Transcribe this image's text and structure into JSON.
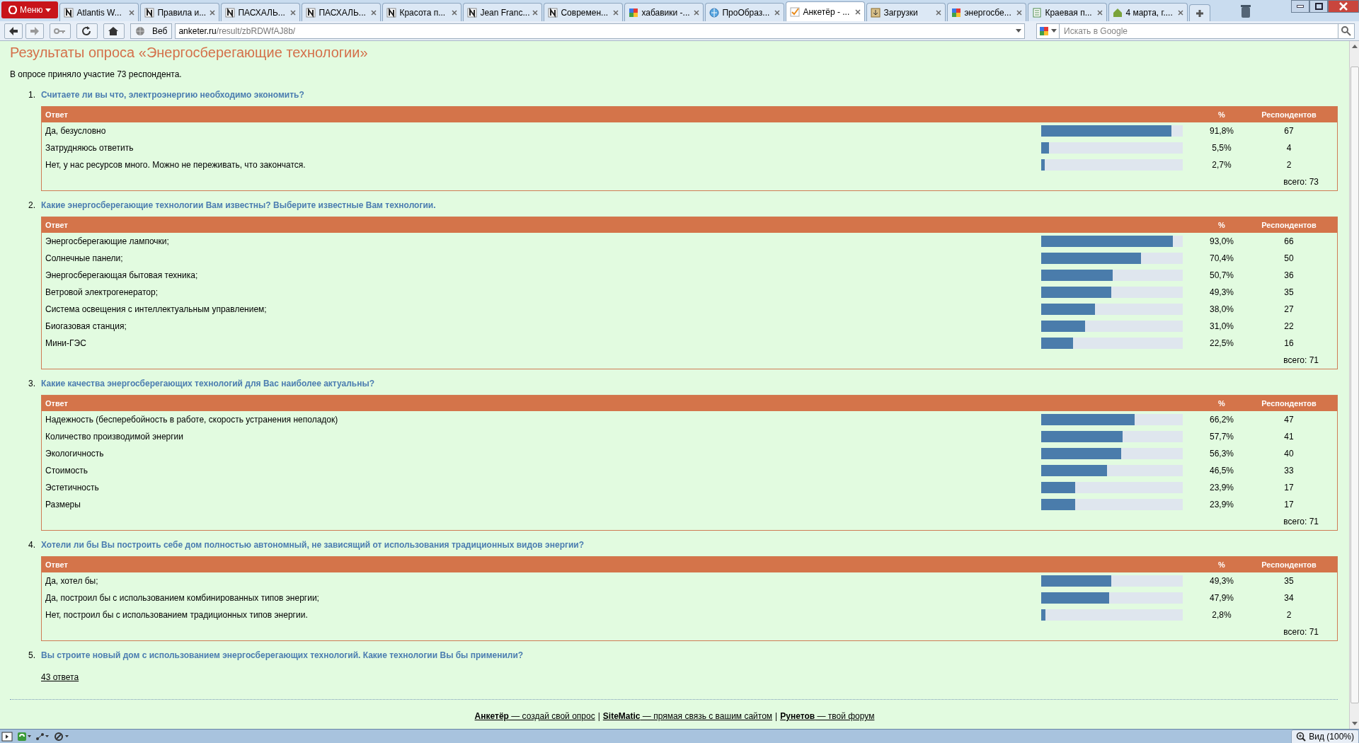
{
  "browser": {
    "menu_label": "Меню",
    "tabs": [
      {
        "title": "Atlantis W...",
        "kind": "n",
        "selected": false
      },
      {
        "title": "Правила и...",
        "kind": "n",
        "selected": false
      },
      {
        "title": "ПАСХАЛЬ...",
        "kind": "n",
        "selected": false
      },
      {
        "title": "ПАСХАЛЬ...",
        "kind": "n",
        "selected": false
      },
      {
        "title": "Красота п...",
        "kind": "n",
        "selected": false
      },
      {
        "title": "Jean Franc...",
        "kind": "n",
        "selected": false
      },
      {
        "title": "Современ...",
        "kind": "n",
        "selected": false
      },
      {
        "title": "хабавики -...",
        "kind": "google",
        "selected": false
      },
      {
        "title": "ПроОбраз...",
        "kind": "globe",
        "selected": false
      },
      {
        "title": "Анкетёр - ...",
        "kind": "check",
        "selected": true
      },
      {
        "title": "Загрузки",
        "kind": "download",
        "selected": false
      },
      {
        "title": "энергосбе...",
        "kind": "google",
        "selected": false
      },
      {
        "title": "Краевая п...",
        "kind": "doc",
        "selected": false
      },
      {
        "title": "4 марта, г....",
        "kind": "house",
        "selected": false
      }
    ],
    "site_label": "Веб",
    "url_host": "anketer.ru",
    "url_path": "/result/zbRDWfAJ8b/",
    "search_placeholder": "Искать в Google",
    "zoom_label": "Вид (100%)"
  },
  "page": {
    "title": "Результаты опроса «Энергосберегающие технологии»",
    "intro": "В опросе приняло участие 73 респондента.",
    "questions": [
      {
        "number": "1.",
        "text": "Считаете ли вы что, электроэнергию необходимо экономить?",
        "columns": [
          "Ответ",
          "%",
          "Респондентов"
        ],
        "total": "всего: 73",
        "rows": [
          {
            "answer": "Да, безусловно",
            "level": 0.918,
            "percent": "91,8%",
            "count": "67"
          },
          {
            "answer": "Затрудняюсь ответить",
            "level": 0.055,
            "percent": "5,5%",
            "count": "4"
          },
          {
            "answer": "Нет, у нас ресурсов много. Можно не переживать, что закончатся.",
            "level": 0.027,
            "percent": "2,7%",
            "count": "2"
          }
        ]
      },
      {
        "number": "2.",
        "text": "Какие энергосберегающие технологии Вам известны? Выберите известные Вам технологии.",
        "columns": [
          "Ответ",
          "%",
          "Респондентов"
        ],
        "total": "всего: 71",
        "rows": [
          {
            "answer": "Энергосберегающие лампочки;",
            "level": 0.93,
            "percent": "93,0%",
            "count": "66"
          },
          {
            "answer": "Солнечные панели;",
            "level": 0.704,
            "percent": "70,4%",
            "count": "50"
          },
          {
            "answer": "Энергосберегающая бытовая техника;",
            "level": 0.507,
            "percent": "50,7%",
            "count": "36"
          },
          {
            "answer": "Ветровой электрогенератор;",
            "level": 0.493,
            "percent": "49,3%",
            "count": "35"
          },
          {
            "answer": "Система освещения с интеллектуальным управлением;",
            "level": 0.38,
            "percent": "38,0%",
            "count": "27"
          },
          {
            "answer": "Биогазовая станция;",
            "level": 0.31,
            "percent": "31,0%",
            "count": "22"
          },
          {
            "answer": "Мини-ГЭС",
            "level": 0.225,
            "percent": "22,5%",
            "count": "16"
          }
        ]
      },
      {
        "number": "3.",
        "text": "Какие качества энергосберегающих технологий для Вас наиболее актуальны?",
        "columns": [
          "Ответ",
          "%",
          "Респондентов"
        ],
        "total": "всего: 71",
        "rows": [
          {
            "answer": "Надежность (бесперебойность в работе, скорость устранения неполадок)",
            "level": 0.662,
            "percent": "66,2%",
            "count": "47"
          },
          {
            "answer": "Количество производимой энергии",
            "level": 0.577,
            "percent": "57,7%",
            "count": "41"
          },
          {
            "answer": "Экологичность",
            "level": 0.563,
            "percent": "56,3%",
            "count": "40"
          },
          {
            "answer": "Стоимость",
            "level": 0.465,
            "percent": "46,5%",
            "count": "33"
          },
          {
            "answer": "Эстетичность",
            "level": 0.239,
            "percent": "23,9%",
            "count": "17"
          },
          {
            "answer": "Размеры",
            "level": 0.239,
            "percent": "23,9%",
            "count": "17"
          }
        ]
      },
      {
        "number": "4.",
        "text": "Хотели ли бы Вы построить себе дом полностью автономный, не зависящий от использования традиционных видов энергии?",
        "columns": [
          "Ответ",
          "%",
          "Респондентов"
        ],
        "total": "всего: 71",
        "rows": [
          {
            "answer": "Да, хотел бы;",
            "level": 0.493,
            "percent": "49,3%",
            "count": "35"
          },
          {
            "answer": "Да, построил бы с использованием комбинированных типов энергии;",
            "level": 0.479,
            "percent": "47,9%",
            "count": "34"
          },
          {
            "answer": "Нет, построил бы с использованием традиционных типов энергии.",
            "level": 0.028,
            "percent": "2,8%",
            "count": "2"
          }
        ]
      },
      {
        "number": "5.",
        "text": "Вы строите новый дом с использованием энергосберегающих технологий. Какие технологии Вы бы применили?",
        "link": "43 ответа"
      }
    ],
    "footer": [
      {
        "kind": "link",
        "text": "**Анкетёр** — создай свой опрос"
      },
      {
        "kind": "separator",
        "text": "|"
      },
      {
        "kind": "link",
        "text": "**SiteMatic** — прямая связь с вашим сайтом"
      },
      {
        "kind": "separator",
        "text": "|"
      },
      {
        "kind": "link",
        "text": "**Рунетов** — твой форум"
      }
    ]
  }
}
